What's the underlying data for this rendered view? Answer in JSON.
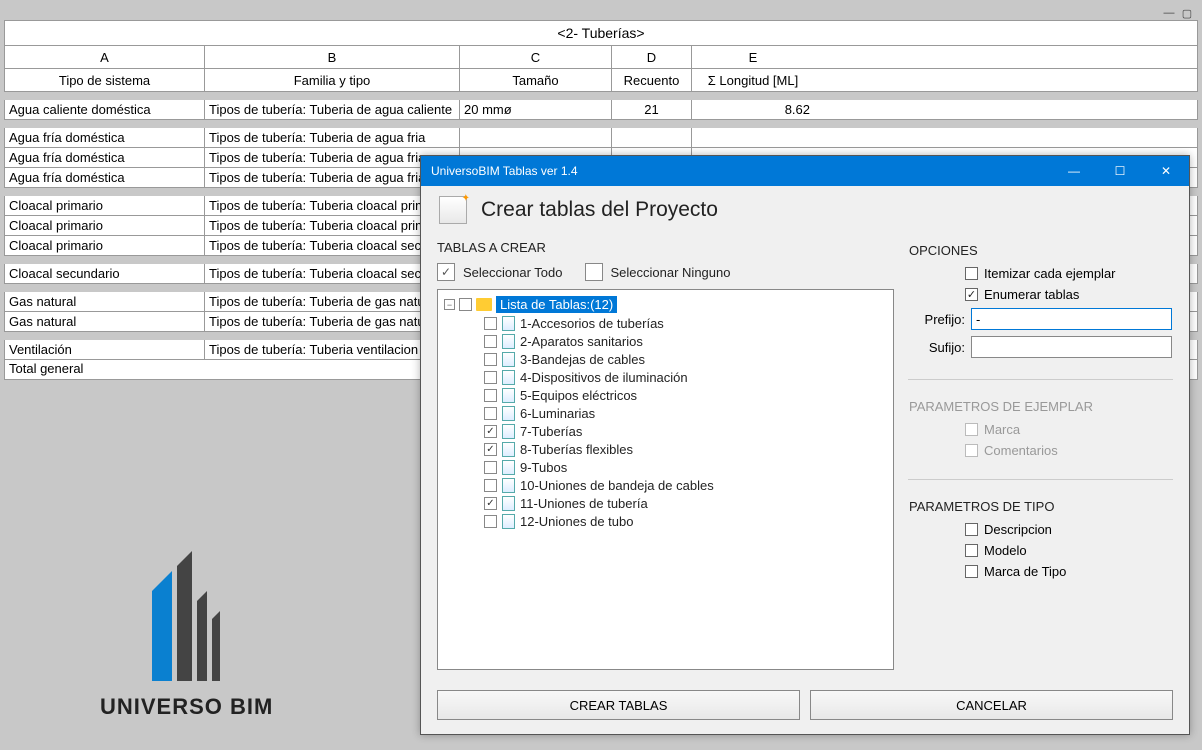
{
  "window": {
    "schedule_title": "<2- Tuberías>",
    "columns": [
      "A",
      "B",
      "C",
      "D",
      "E"
    ],
    "fields": [
      "Tipo de sistema",
      "Familia y tipo",
      "Tamaño",
      "Recuento",
      "Σ Longitud [ML]"
    ],
    "total_label": "Total general"
  },
  "rows": [
    {
      "a": "Agua caliente doméstica",
      "b": "Tipos de tubería: Tuberia de agua caliente",
      "c": "20 mmø",
      "d": "21",
      "e": "8.62",
      "sep_after": true
    },
    {
      "a": "Agua fría doméstica",
      "b": "Tipos de tubería: Tuberia de agua fria",
      "c": "",
      "d": "",
      "e": ""
    },
    {
      "a": "Agua fría doméstica",
      "b": "Tipos de tubería: Tuberia de agua fria",
      "c": "",
      "d": "",
      "e": ""
    },
    {
      "a": "Agua fría doméstica",
      "b": "Tipos de tubería: Tuberia de agua fria",
      "c": "",
      "d": "",
      "e": "",
      "sep_after": true
    },
    {
      "a": "Cloacal primario",
      "b": "Tipos de tubería: Tuberia cloacal primaria",
      "c": "",
      "d": "",
      "e": ""
    },
    {
      "a": "Cloacal primario",
      "b": "Tipos de tubería: Tuberia cloacal primaria",
      "c": "",
      "d": "",
      "e": ""
    },
    {
      "a": "Cloacal primario",
      "b": "Tipos de tubería: Tuberia cloacal secundaria",
      "c": "",
      "d": "",
      "e": "",
      "sep_after": true
    },
    {
      "a": "Cloacal secundario",
      "b": "Tipos de tubería: Tuberia cloacal secundaria",
      "c": "",
      "d": "",
      "e": "",
      "sep_after": true
    },
    {
      "a": "Gas natural",
      "b": "Tipos de tubería: Tuberia de gas natural",
      "c": "",
      "d": "",
      "e": ""
    },
    {
      "a": "Gas natural",
      "b": "Tipos de tubería: Tuberia de gas natural",
      "c": "",
      "d": "",
      "e": "",
      "sep_after": true
    },
    {
      "a": "Ventilación",
      "b": "Tipos de tubería: Tuberia ventilacion",
      "c": "",
      "d": "",
      "e": ""
    }
  ],
  "logo": {
    "text_a": "UNIVERSO",
    "text_b": "BIM"
  },
  "dialog": {
    "titlebar": "UniversoBIM Tablas ver 1.4",
    "header": "Crear tablas del Proyecto",
    "tablas_label": "TABLAS A CREAR",
    "select_all": "Seleccionar Todo",
    "select_none": "Seleccionar Ninguno",
    "tree_root": "Lista de Tablas:(12)",
    "tree_items": [
      {
        "label": "1-Accesorios de tuberías",
        "checked": false
      },
      {
        "label": "2-Aparatos sanitarios",
        "checked": false
      },
      {
        "label": "3-Bandejas de cables",
        "checked": false
      },
      {
        "label": "4-Dispositivos de iluminación",
        "checked": false
      },
      {
        "label": "5-Equipos eléctricos",
        "checked": false
      },
      {
        "label": "6-Luminarias",
        "checked": false
      },
      {
        "label": "7-Tuberías",
        "checked": true
      },
      {
        "label": "8-Tuberías flexibles",
        "checked": true
      },
      {
        "label": "9-Tubos",
        "checked": false
      },
      {
        "label": "10-Uniones de bandeja de cables",
        "checked": false
      },
      {
        "label": "11-Uniones de tubería",
        "checked": true
      },
      {
        "label": "12-Uniones de tubo",
        "checked": false
      }
    ],
    "opciones_label": "OPCIONES",
    "opt_itemizar": "Itemizar cada ejemplar",
    "opt_enumerar": "Enumerar tablas",
    "prefijo_label": "Prefijo:",
    "prefijo_value": "-",
    "sufijo_label": "Sufijo:",
    "sufijo_value": "",
    "param_ejemplar_label": "PARAMETROS DE EJEMPLAR",
    "pe_marca": "Marca",
    "pe_comentarios": "Comentarios",
    "param_tipo_label": "PARAMETROS DE TIPO",
    "pt_desc": "Descripcion",
    "pt_modelo": "Modelo",
    "pt_marcatipo": "Marca de Tipo",
    "btn_crear": "CREAR TABLAS",
    "btn_cancelar": "CANCELAR"
  }
}
